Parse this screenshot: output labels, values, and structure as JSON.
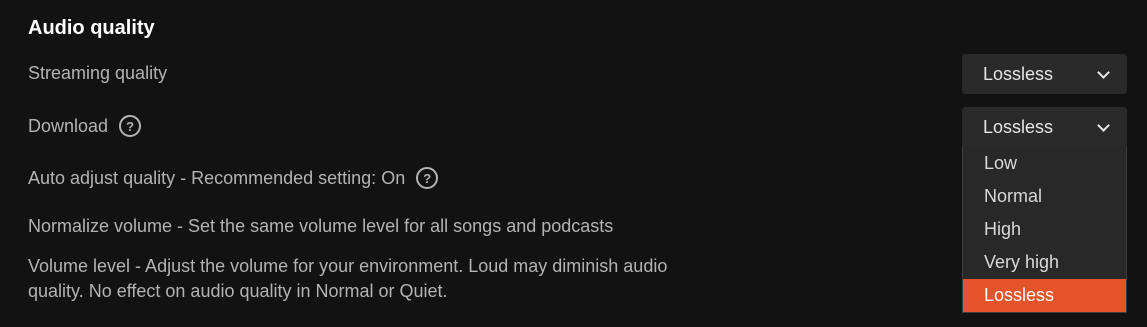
{
  "section": {
    "title": "Audio quality"
  },
  "rows": {
    "streaming": {
      "label": "Streaming quality",
      "value": "Lossless"
    },
    "download": {
      "label": "Download",
      "value": "Lossless"
    },
    "auto_adjust": {
      "label": "Auto adjust quality - Recommended setting: On"
    },
    "normalize": {
      "label": "Normalize volume - Set the same volume level for all songs and podcasts"
    },
    "volume_level": {
      "label": "Volume level - Adjust the volume for your environment. Loud may diminish audio quality. No effect on audio quality in Normal or Quiet."
    }
  },
  "help_glyph": "?",
  "dropdown": {
    "options": [
      "Low",
      "Normal",
      "High",
      "Very high",
      "Lossless"
    ],
    "selected": "Lossless"
  },
  "colors": {
    "background": "#121212",
    "accent": "#e5532a",
    "control": "#2a2a2a"
  },
  "icons": [
    "help-icon",
    "chevron-down-icon"
  ]
}
